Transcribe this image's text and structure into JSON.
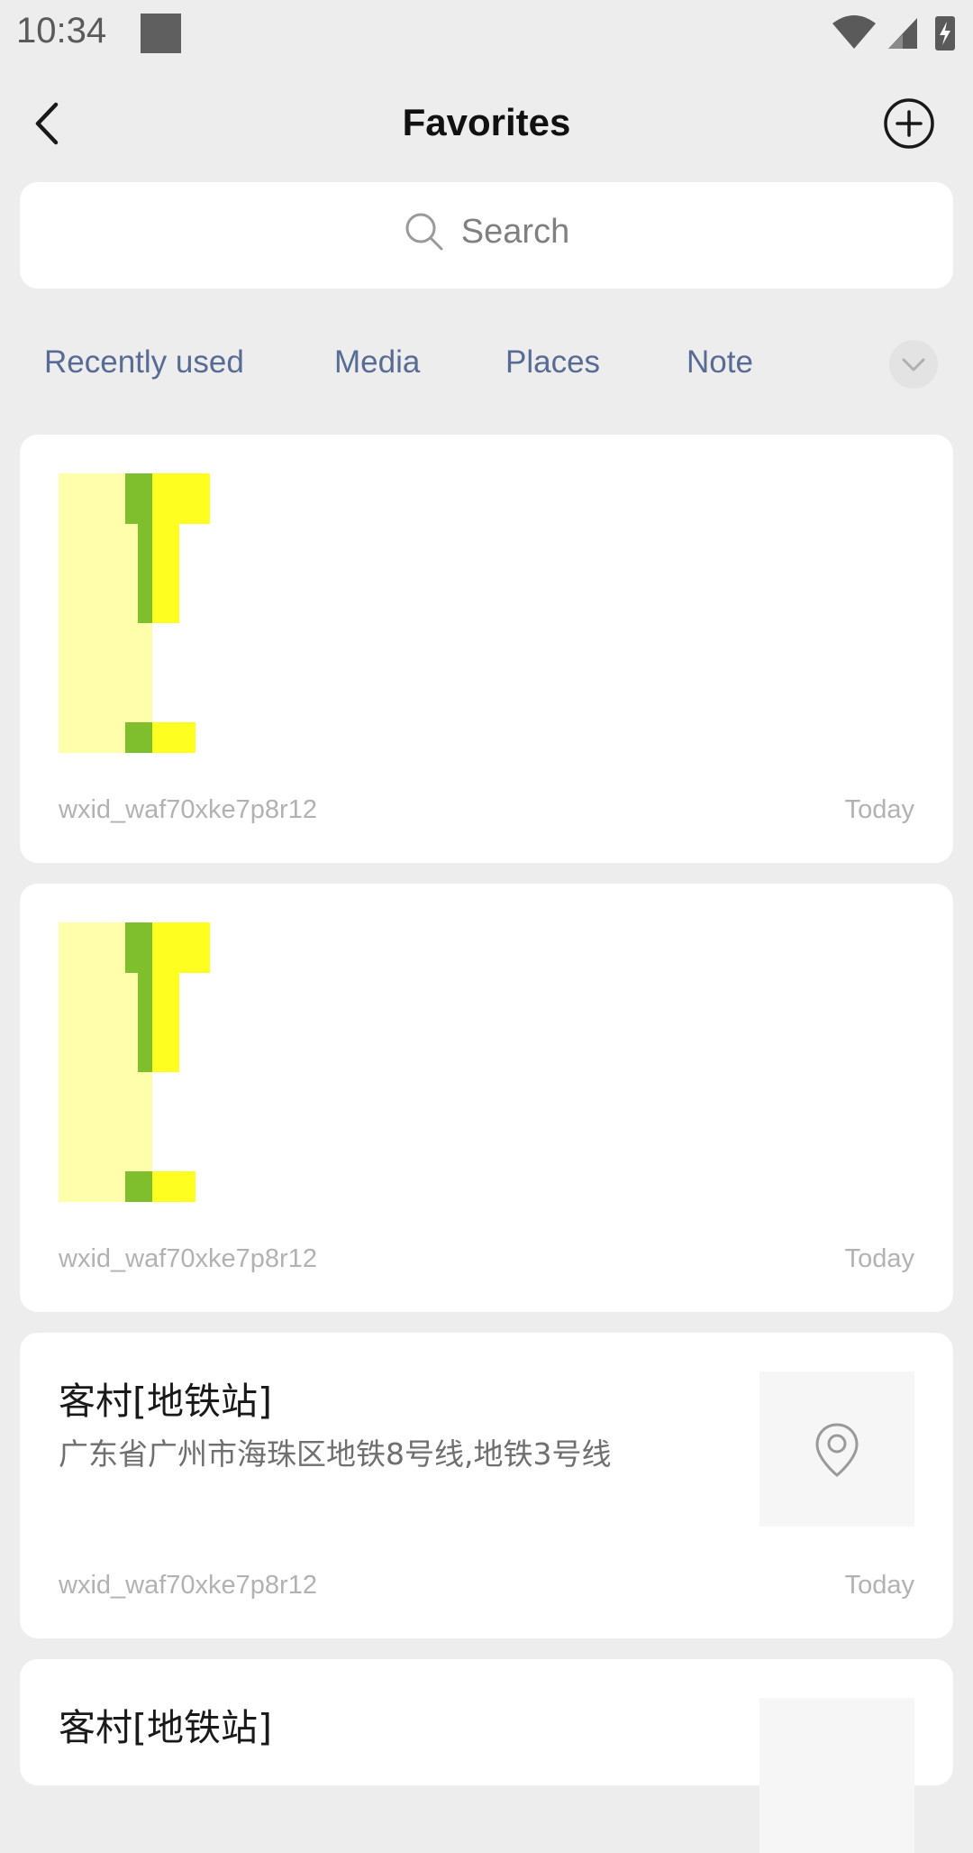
{
  "status_bar": {
    "time": "10:34",
    "icons": [
      "square-icon",
      "wifi-icon",
      "signal-icon",
      "battery-charging-icon"
    ]
  },
  "header": {
    "title": "Favorites",
    "back_icon": "chevron-left-icon",
    "add_icon": "plus-circle-icon"
  },
  "search": {
    "label": "Search",
    "icon": "search-icon"
  },
  "tabs": [
    {
      "label": "Recently used"
    },
    {
      "label": "Media"
    },
    {
      "label": "Places"
    },
    {
      "label": "Note"
    }
  ],
  "expand_icon": "chevron-down-icon",
  "colors": {
    "accent": "#576b95",
    "background": "#ededed",
    "thumbnail_green": "#7fbe2d",
    "thumbnail_yellow": "#fefe20",
    "thumbnail_pale_yellow": "#fefeab"
  },
  "favorites": [
    {
      "type": "image",
      "source": "wxid_waf70xke7p8r12",
      "time": "Today"
    },
    {
      "type": "image",
      "source": "wxid_waf70xke7p8r12",
      "time": "Today"
    },
    {
      "type": "location",
      "title": "客村[地铁站]",
      "address": "广东省广州市海珠区地铁8号线,地铁3号线",
      "source": "wxid_waf70xke7p8r12",
      "time": "Today",
      "icon": "location-pin-icon"
    },
    {
      "type": "location",
      "title": "客村[地铁站]"
    }
  ]
}
